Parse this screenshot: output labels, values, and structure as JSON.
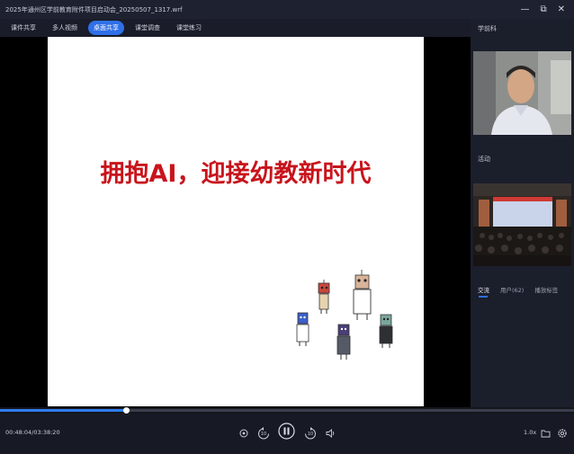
{
  "window": {
    "title": "2025年通州区学前教育附件项目启动会_20250507_1317.wrf",
    "controls": [
      "—",
      "⧉",
      "✕"
    ]
  },
  "tabs": [
    {
      "label": "课件共享",
      "active": false
    },
    {
      "label": "多人视频",
      "active": false
    },
    {
      "label": "桌面共享",
      "active": true
    },
    {
      "label": "课堂调查",
      "active": false
    },
    {
      "label": "课堂练习",
      "active": false
    }
  ],
  "slide": {
    "title": "拥抱AI，迎接幼教新时代"
  },
  "panel": {
    "presenter_label": "学前科",
    "event_label": "活动",
    "subtabs": [
      {
        "label": "交流",
        "active": true
      },
      {
        "label": "用户(62)",
        "active": false
      },
      {
        "label": "播放标签",
        "active": false
      }
    ]
  },
  "playback": {
    "current": "00:48:04",
    "total": "03:38:20",
    "time_text": "00:48:04/03:38:20",
    "progress_fraction": 0.2201,
    "rewind_seconds": "10",
    "forward_seconds": "10",
    "speed": "1.0x"
  },
  "colors": {
    "accent": "#2f6fe8",
    "slide_title": "#c8141c",
    "background": "#14161d"
  },
  "icons": {
    "prev": "circle-dot-icon",
    "rewind": "rewind-10-icon",
    "play_pause": "pause-icon",
    "forward": "forward-10-icon",
    "volume": "volume-icon",
    "folder": "folder-icon",
    "settings": "gear-icon"
  }
}
